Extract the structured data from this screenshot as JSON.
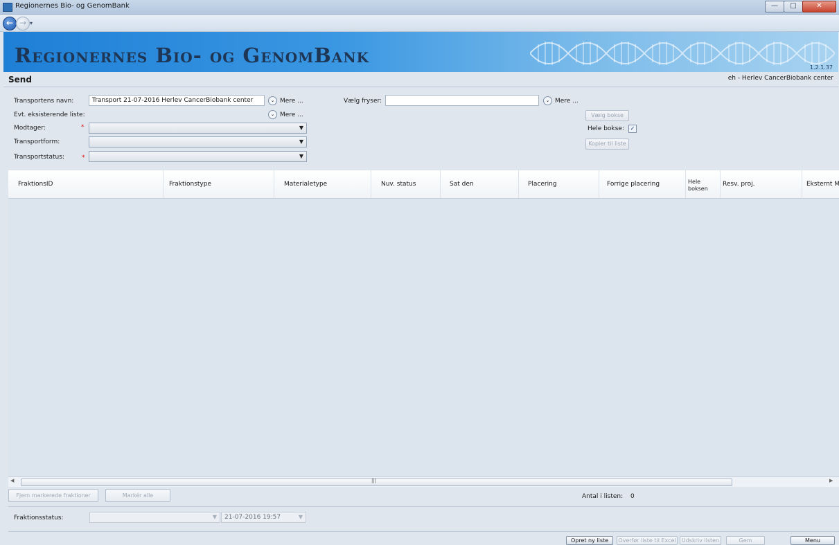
{
  "window": {
    "title": "Regionernes Bio- og GenomBank"
  },
  "banner": {
    "title": "Regionernes Bio- og GenomBank",
    "version": "1.2.1.37"
  },
  "header": {
    "page_title": "Send",
    "user_center": "eh - Herlev CancerBiobank center"
  },
  "form": {
    "transport_name_label": "Transportens navn:",
    "transport_name_value": "Transport 21-07-2016 Herlev CancerBiobank center",
    "more_label": "Mere ...",
    "existing_list_label": "Evt. eksisterende liste:",
    "receiver_label": "Modtager:",
    "transport_form_label": "Transportform:",
    "transport_status_label": "Transportstatus:",
    "required_mark": "*",
    "choose_freezer_label": "Vælg fryser:",
    "choose_box_button": "Vælg bokse",
    "whole_boxes_label": "Hele bokse:",
    "whole_boxes_checked": true,
    "copy_to_list_button": "Kopier til liste"
  },
  "grid": {
    "columns": [
      "FraktionsID",
      "Fraktionstype",
      "Materialetype",
      "Nuv. status",
      "Sat den",
      "Placering",
      "Forrige placering",
      "Hele boksen",
      "Resv. proj.",
      "Eksternt M"
    ],
    "rows": []
  },
  "footer": {
    "remove_selected_button": "Fjern markerede fraktioner",
    "mark_all_button": "Markér alle",
    "count_label": "Antal i listen:",
    "count_value": "0",
    "fraction_status_label": "Fraktionsstatus:",
    "fraction_status_value": "",
    "date_value": "21-07-2016 19:57",
    "new_list_button": "Opret ny liste",
    "excel_button": "Overfør liste til Excel",
    "print_button": "Udskriv listen",
    "save_button": "Gem",
    "menu_button": "Menu"
  }
}
